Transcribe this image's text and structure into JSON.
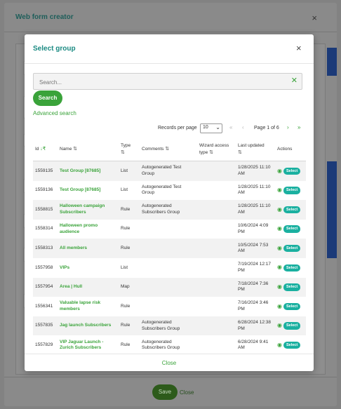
{
  "background": {
    "title": "Web form creator",
    "save_label": "Save",
    "close_label": "Close"
  },
  "modal": {
    "title": "Select group",
    "search_placeholder": "Search...",
    "search_button": "Search",
    "advanced_search": "Advanced search",
    "records_per_page_label": "Records per page",
    "records_per_page_value": "10",
    "page_info": "Page 1 of 6",
    "close_label": "Close"
  },
  "table": {
    "headers": {
      "id": "Id",
      "name": "Name",
      "type": "Type",
      "comments": "Comments",
      "wizard": "Wizard access type",
      "updated": "Last updated",
      "actions": "Actions"
    },
    "select_label": "Select",
    "rows": [
      {
        "id": "1559135",
        "name": "Test Group [87685]",
        "type": "List",
        "comments": "Autogenerated Test Group",
        "wizard": "",
        "updated": "1/28/2025 11:10 AM"
      },
      {
        "id": "1559136",
        "name": "Test Group [87685]",
        "type": "List",
        "comments": "Autogenerated Test Group",
        "wizard": "",
        "updated": "1/28/2025 11:10 AM"
      },
      {
        "id": "1558815",
        "name": "Halloween campaign Subscribers",
        "type": "Rule",
        "comments": "Autogenerated Subscribers Group",
        "wizard": "",
        "updated": "1/28/2025 11:10 AM"
      },
      {
        "id": "1558314",
        "name": "Halloween promo audience",
        "type": "Rule",
        "comments": "",
        "wizard": "",
        "updated": "10/6/2024 4:09 PM"
      },
      {
        "id": "1558313",
        "name": "All members",
        "type": "Rule",
        "comments": "",
        "wizard": "",
        "updated": "10/5/2024 7:53 AM"
      },
      {
        "id": "1557958",
        "name": "VIPs",
        "type": "List",
        "comments": "",
        "wizard": "",
        "updated": "7/19/2024 12:17 PM"
      },
      {
        "id": "1557954",
        "name": "Area | Hull",
        "type": "Map",
        "comments": "",
        "wizard": "",
        "updated": "7/18/2024 7:36 PM"
      },
      {
        "id": "1556341",
        "name": "Valuable lapse risk members",
        "type": "Rule",
        "comments": "",
        "wizard": "",
        "updated": "7/16/2024 3:46 PM"
      },
      {
        "id": "1557835",
        "name": "Jag launch Subscribers",
        "type": "Rule",
        "comments": "Autogenerated Subscribers Group",
        "wizard": "",
        "updated": "6/28/2024 12:38 PM"
      },
      {
        "id": "1557829",
        "name": "VIP Jaguar Launch - Zurich Subscribers",
        "type": "Rule",
        "comments": "Autogenerated Subscribers Group",
        "wizard": "",
        "updated": "6/28/2024 9:41 AM"
      }
    ]
  }
}
